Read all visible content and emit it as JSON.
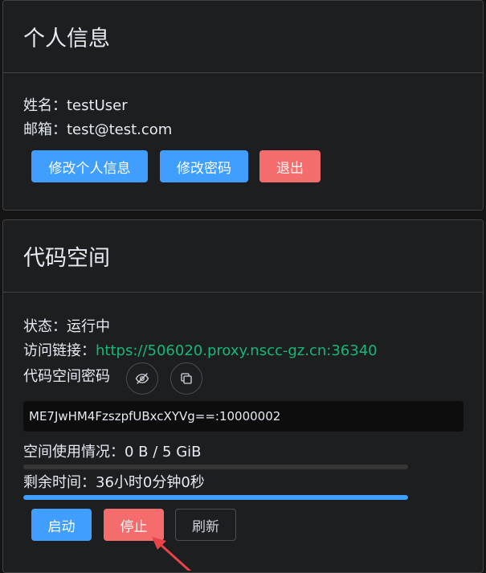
{
  "profile": {
    "title": "个人信息",
    "name_line": "姓名：testUser",
    "email_line": "邮箱：test@test.com",
    "edit_profile_label": "修改个人信息",
    "change_password_label": "修改密码",
    "logout_label": "退出"
  },
  "workspace": {
    "title": "代码空间",
    "status_line": "状态：运行中",
    "access_label": "访问链接：",
    "access_url": "https://506020.proxy.nscc-gz.cn:36340",
    "password_label": "代码空间密码",
    "password_value": "ME7JwHM4FzszpfUBxcXYVg==:10000002",
    "usage_line": "空间使用情况：0 B / 5 GiB",
    "usage_fraction": 0,
    "remaining_line": "剩余时间：36小时0分钟0秒",
    "remaining_fraction": 1,
    "start_label": "启动",
    "stop_label": "停止",
    "refresh_label": "刷新"
  },
  "colors": {
    "primary": "#409eff",
    "danger": "#f56c6c",
    "link": "#16b777",
    "annotation_arrow": "#e8424a"
  }
}
